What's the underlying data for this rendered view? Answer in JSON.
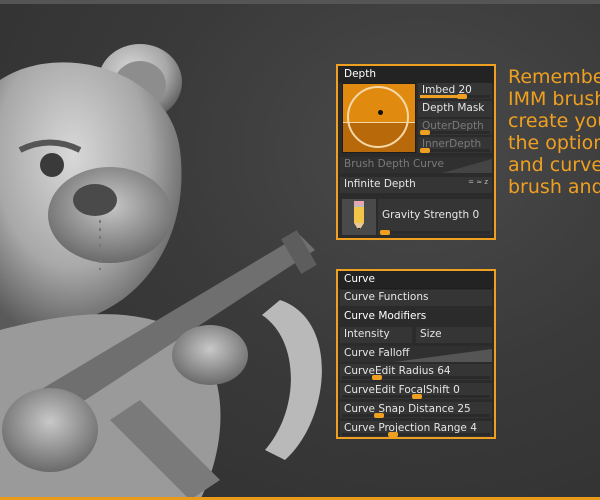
{
  "caption_lines": [
    "Remember",
    "IMM brush",
    "create you",
    "the option",
    "and curve c",
    "brush and"
  ],
  "depth_panel": {
    "title": "Depth",
    "imbed_label": "Imbed 20",
    "imbed_level": 0.6,
    "depth_mask": "Depth Mask",
    "outer_depth": "OuterDepth",
    "inner_depth": "InnerDepth",
    "brush_depth_curve": "Brush Depth Curve",
    "infinite_depth": "Infinite Depth",
    "infinite_depth_icons": "= ≈ z",
    "gravity_strength": "Gravity Strength 0"
  },
  "curve_panel": {
    "title": "Curve",
    "curve_functions": "Curve Functions",
    "curve_modifiers": "Curve Modifiers",
    "intensity": "Intensity",
    "size": "Size",
    "curve_falloff": "Curve Falloff",
    "curveedit_radius": "CurveEdit Radius 64",
    "curveedit_focalshift": "CurveEdit FocalShift 0",
    "curve_snap_distance": "Curve Snap Distance 25",
    "curve_projection_range": "Curve Projection Range 4"
  },
  "colors": {
    "accent": "#f0a020",
    "panel_bg": "#2b2b2b",
    "background": "#3a3a3a"
  },
  "icons": [
    "pencil-icon",
    "bear-sculpt-image"
  ]
}
